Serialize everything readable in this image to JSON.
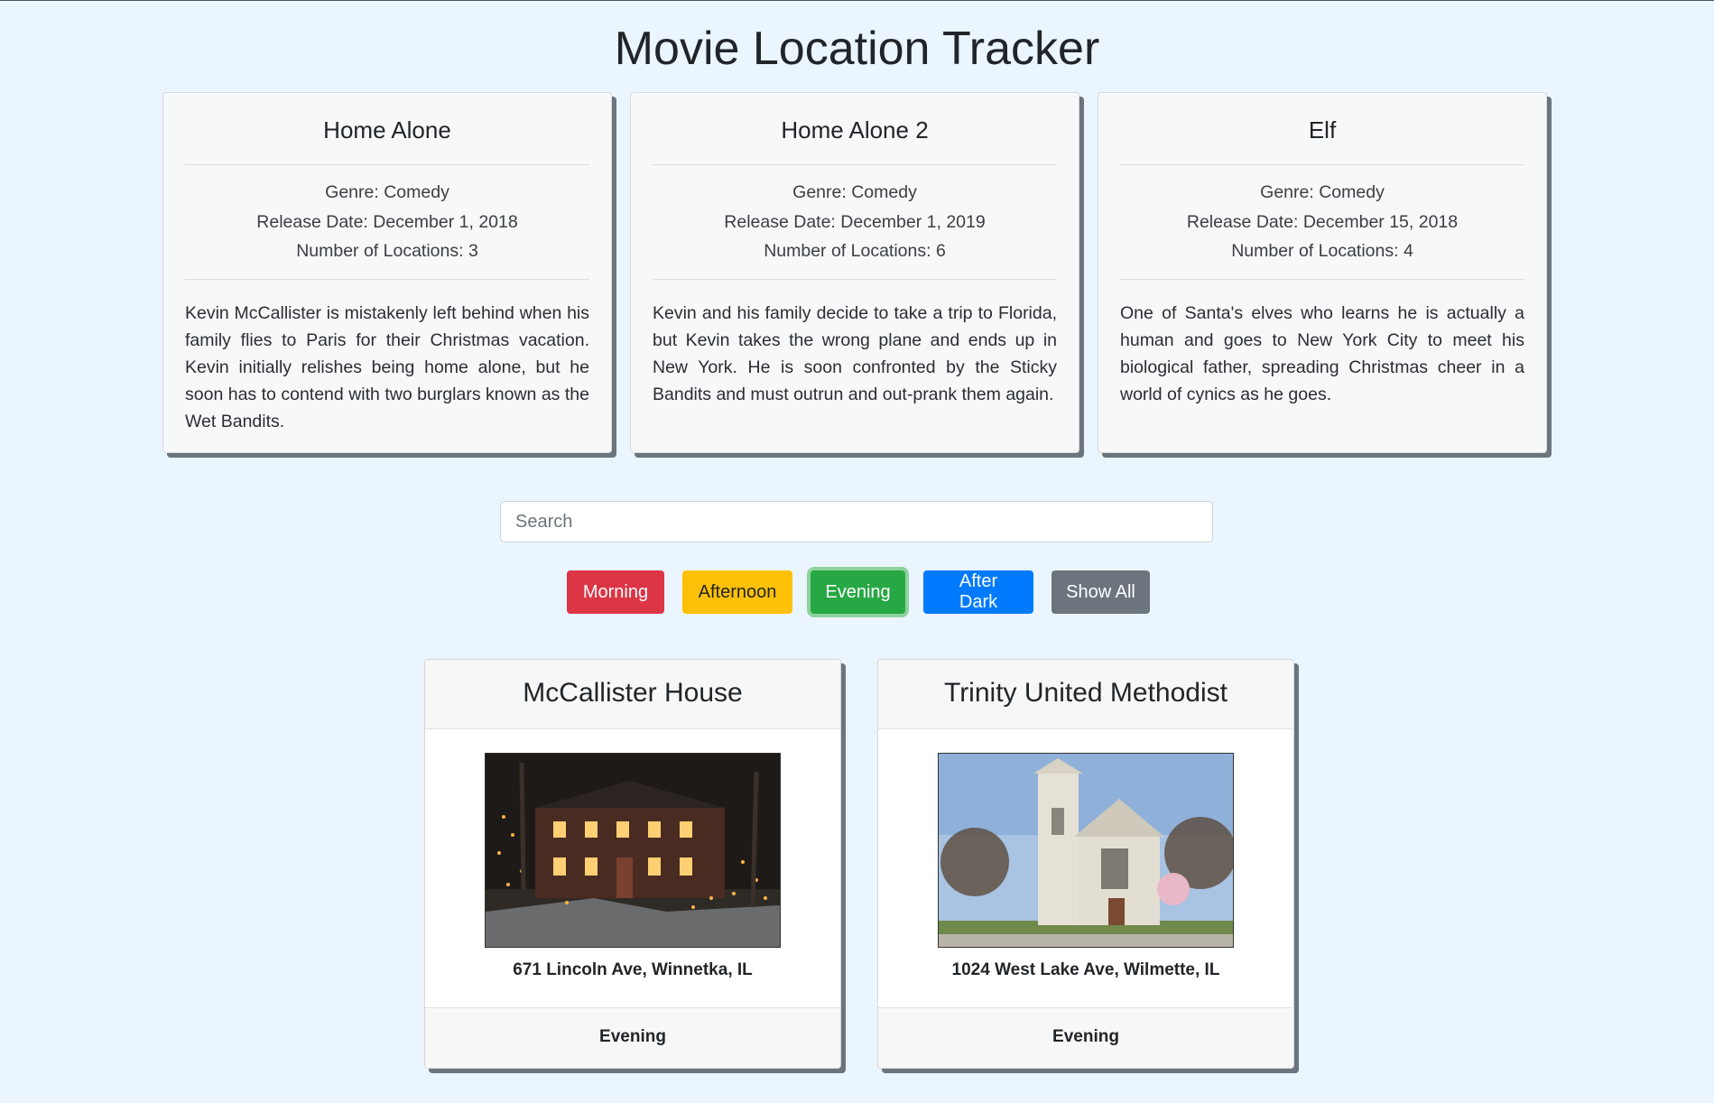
{
  "title": "Movie Location Tracker",
  "movies": [
    {
      "title": "Home Alone",
      "genre": "Genre: Comedy",
      "release": "Release Date: December 1, 2018",
      "locations": "Number of Locations: 3",
      "description": "Kevin McCallister is mistakenly left behind when his family flies to Paris for their Christmas vacation. Kevin initially relishes being home alone, but he soon has to contend with two burglars known as the Wet Bandits."
    },
    {
      "title": "Home Alone 2",
      "genre": "Genre: Comedy",
      "release": "Release Date: December 1, 2019",
      "locations": "Number of Locations: 6",
      "description": "Kevin and his family decide to take a trip to Florida, but Kevin takes the wrong plane and ends up in New York. He is soon confronted by the Sticky Bandits and must outrun and out-prank them again."
    },
    {
      "title": "Elf",
      "genre": "Genre: Comedy",
      "release": "Release Date: December 15, 2018",
      "locations": "Number of Locations: 4",
      "description": "One of Santa's elves who learns he is actually a human and goes to New York City to meet his biological father, spreading Christmas cheer in a world of cynics as he goes."
    }
  ],
  "search": {
    "placeholder": "Search",
    "value": ""
  },
  "filters": {
    "morning": "Morning",
    "afternoon": "Afternoon",
    "evening": "Evening",
    "after_dark": "After Dark",
    "show_all": "Show All",
    "active": "Evening"
  },
  "location_cards": [
    {
      "name": "McCallister House",
      "address": "671 Lincoln Ave, Winnetka, IL",
      "time": "Evening"
    },
    {
      "name": "Trinity United Methodist",
      "address": "1024 West Lake Ave, Wilmette, IL",
      "time": "Evening"
    }
  ],
  "colors": {
    "background": "#ebf5fe",
    "morning": "#dc3545",
    "afternoon": "#ffc107",
    "evening": "#28a745",
    "after_dark": "#007bff",
    "show_all": "#6c757d"
  }
}
